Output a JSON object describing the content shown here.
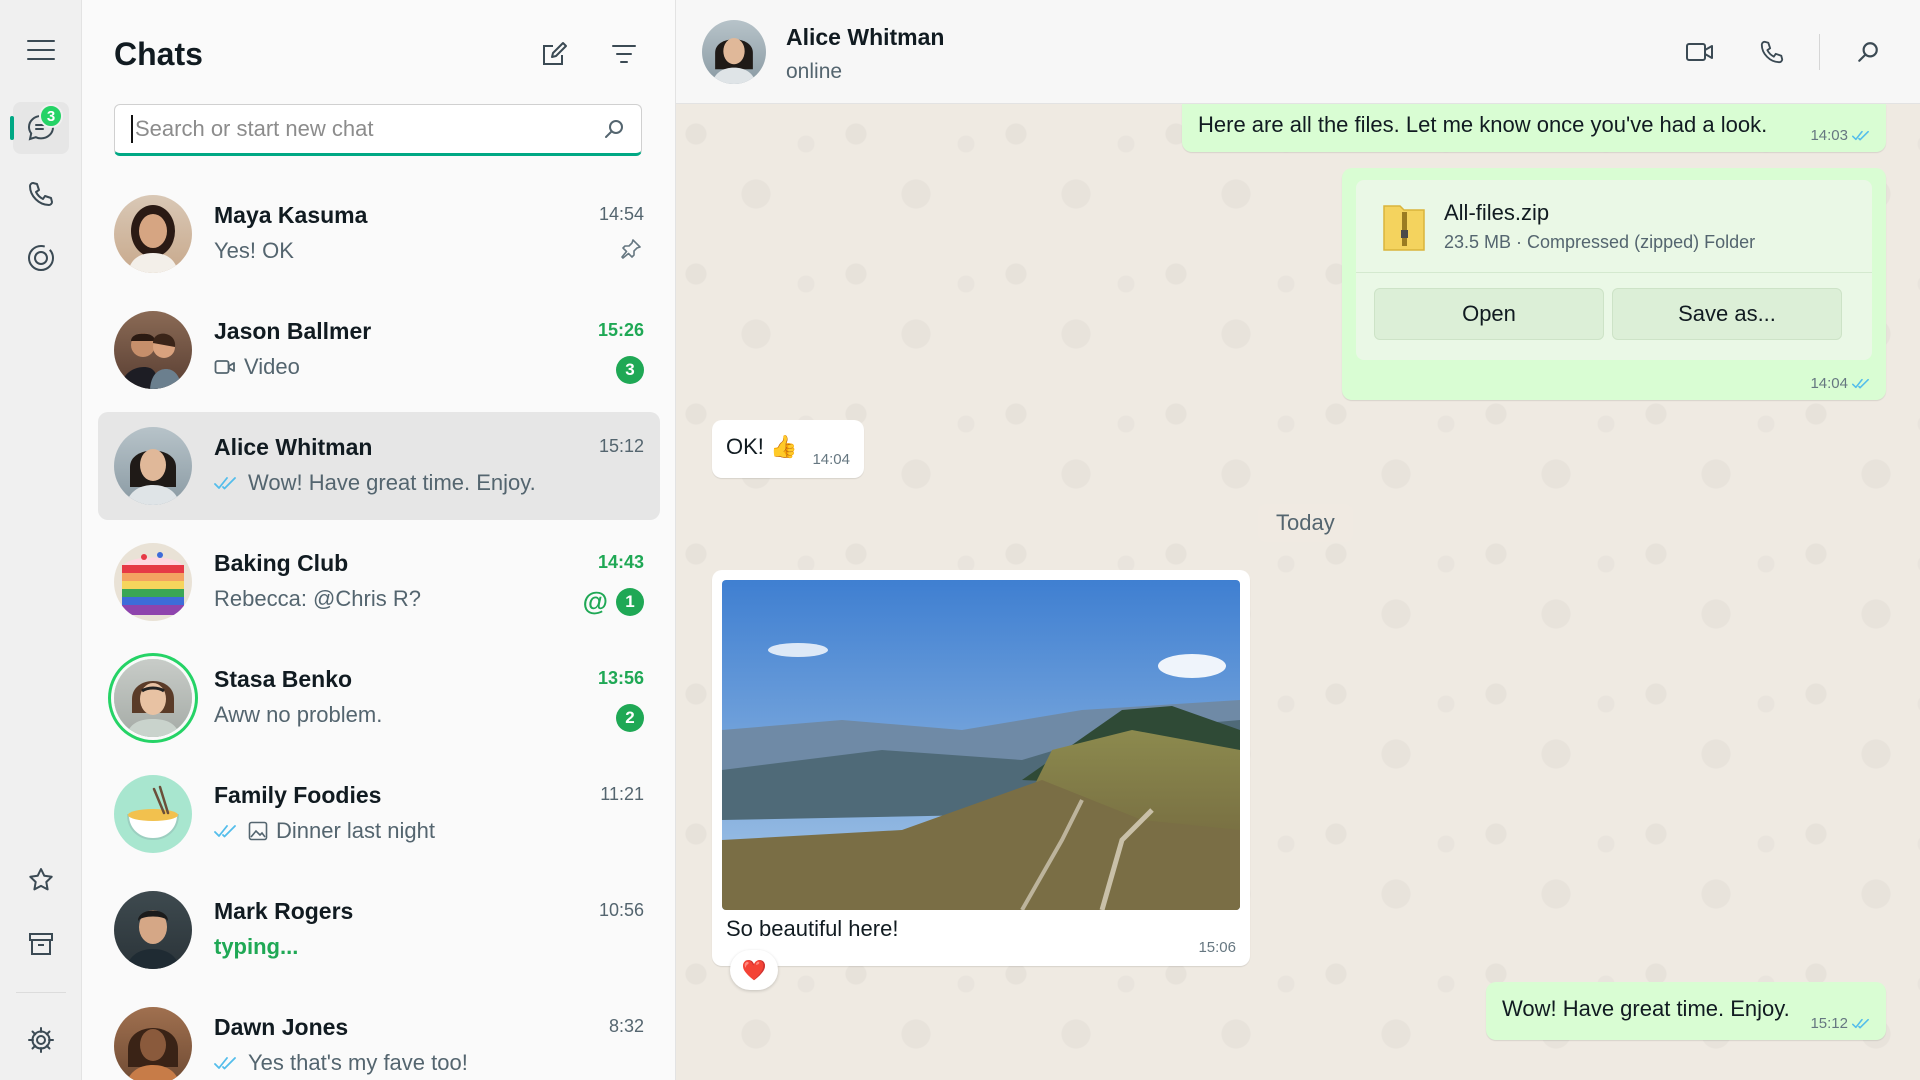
{
  "rail": {
    "chats_badge": "3"
  },
  "list": {
    "title": "Chats",
    "search_placeholder": "Search or start new chat",
    "chats": [
      {
        "name": "Maya Kasuma",
        "preview": "Yes! OK",
        "time": "14:54"
      },
      {
        "name": "Jason Ballmer",
        "preview": "Video",
        "time": "15:26",
        "badge": "3"
      },
      {
        "name": "Alice Whitman",
        "preview": "Wow! Have great time. Enjoy.",
        "time": "15:12"
      },
      {
        "name": "Baking Club",
        "preview": "Rebecca: @Chris R?",
        "time": "14:43",
        "mention": "@",
        "badge": "1"
      },
      {
        "name": "Stasa Benko",
        "preview": "Aww no problem.",
        "time": "13:56",
        "badge": "2"
      },
      {
        "name": "Family Foodies",
        "preview": "Dinner last night",
        "time": "11:21"
      },
      {
        "name": "Mark Rogers",
        "preview": "typing...",
        "time": "10:56"
      },
      {
        "name": "Dawn Jones",
        "preview": "Yes that's my fave too!",
        "time": "8:32"
      }
    ]
  },
  "conversation": {
    "contact_name": "Alice Whitman",
    "status": "online",
    "messages": {
      "m1": {
        "text": "Here are all the files. Let me know once you've had a look.",
        "time": "14:03"
      },
      "m2": {
        "file_name": "All-files.zip",
        "file_info": "23.5 MB · Compressed (zipped) Folder",
        "open_label": "Open",
        "save_label": "Save as...",
        "time": "14:04"
      },
      "m3": {
        "text": "OK! 👍",
        "time": "14:04"
      },
      "day_separator": "Today",
      "m4": {
        "caption": "So beautiful here!",
        "time": "15:06",
        "reaction": "❤️"
      },
      "m5": {
        "text": "Wow! Have great time. Enjoy.",
        "time": "15:12"
      }
    }
  },
  "colors": {
    "accent": "#00a884",
    "unread_green": "#1fa855",
    "outgoing_bubble": "#d9fdd3",
    "incoming_bubble": "#ffffff",
    "read_tick": "#53bdeb"
  }
}
